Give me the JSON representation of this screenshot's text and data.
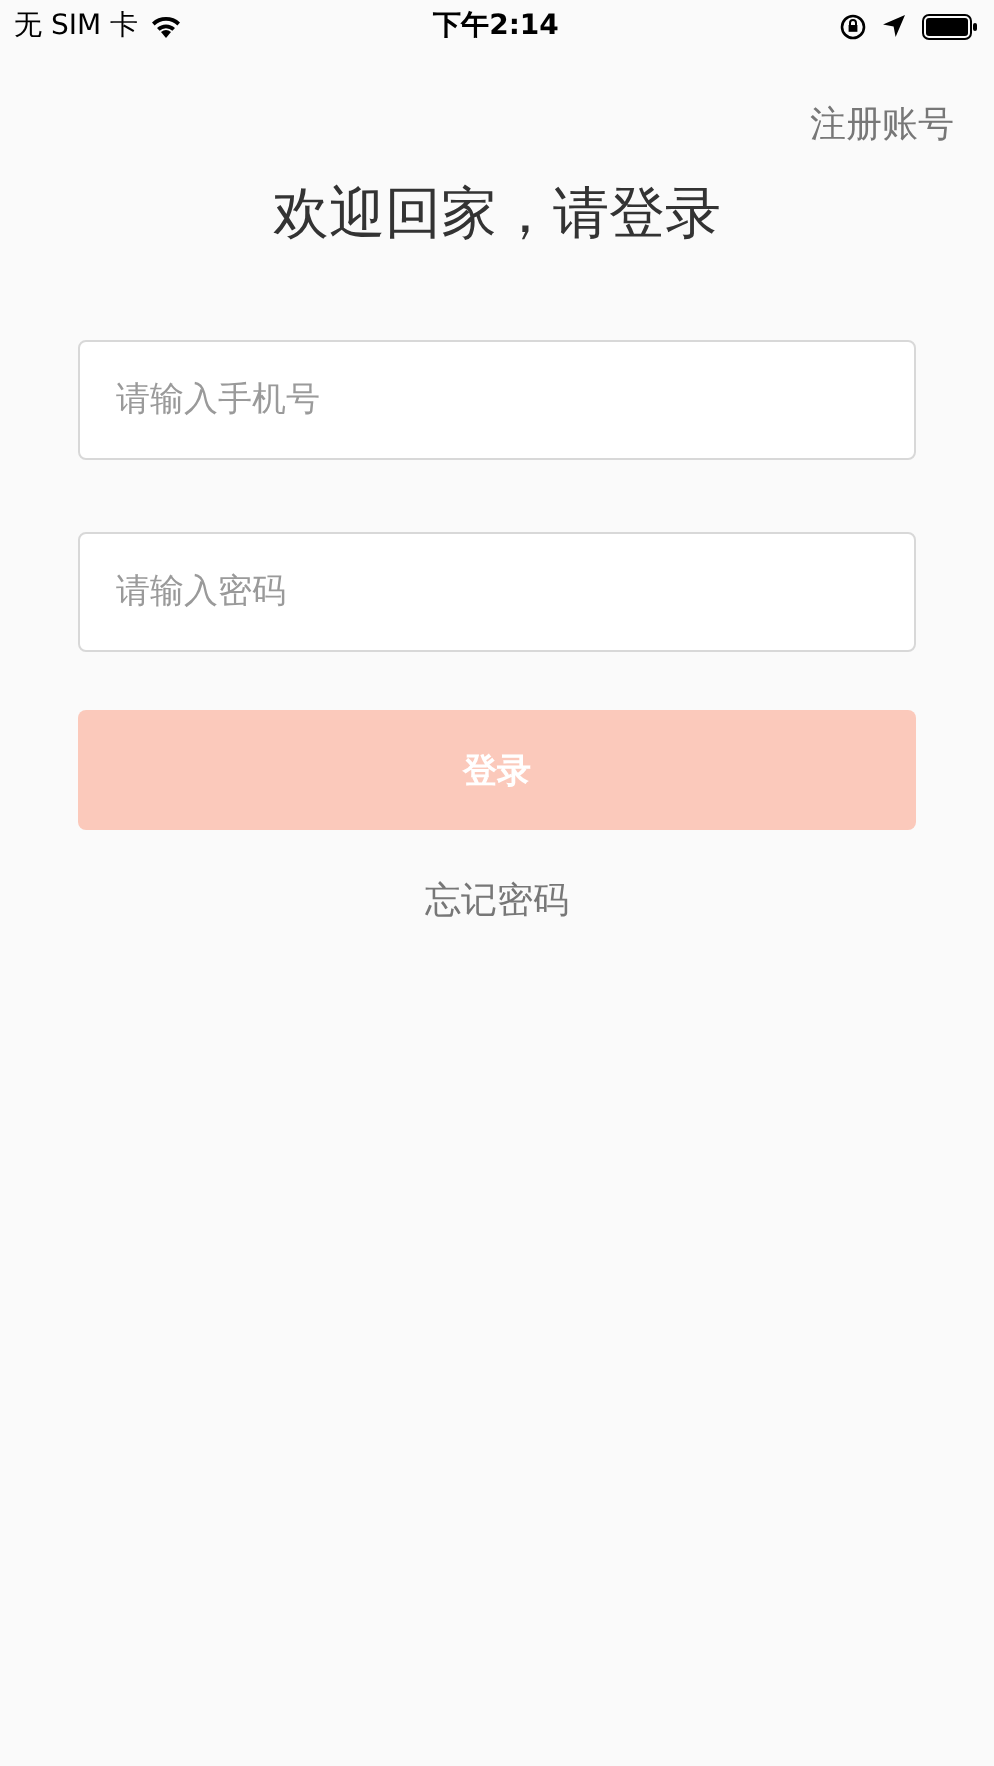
{
  "status_bar": {
    "carrier": "无 SIM 卡",
    "time": "下午2:14"
  },
  "register_link": "注册账号",
  "title": "欢迎回家，请登录",
  "fields": [
    {
      "placeholder": "请输入手机号"
    },
    {
      "placeholder": "请输入密码"
    }
  ],
  "login_button": {
    "label": "登录",
    "disabled": true
  },
  "forgot_link": "忘记密码"
}
